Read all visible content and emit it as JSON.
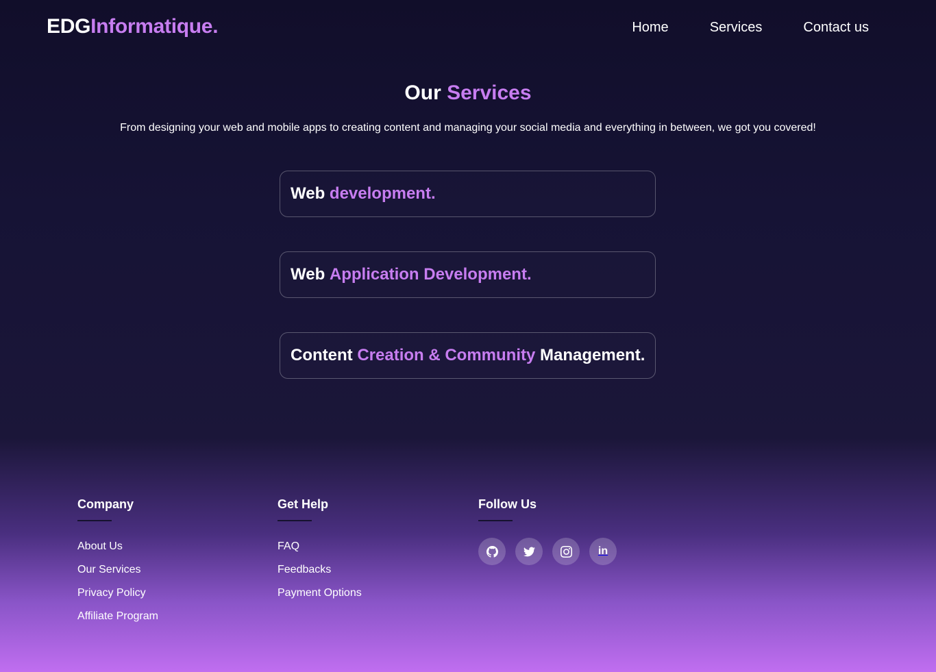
{
  "header": {
    "logo_main": "EDG",
    "logo_accent": "Informatique.",
    "nav": [
      {
        "label": "Home"
      },
      {
        "label": "Services"
      },
      {
        "label": "Contact us"
      }
    ]
  },
  "services": {
    "title_white": "Our",
    "title_accent": "Services",
    "subtitle": "From designing your web and mobile apps to creating content and managing your social media and everything in between, we got you covered!",
    "cards": [
      {
        "part1": "Web",
        "part2": "development."
      },
      {
        "part1": "Web",
        "part2": "Application Development."
      },
      {
        "part1": "Content",
        "part2": "Creation & Community",
        "part3": "Management."
      }
    ]
  },
  "footer": {
    "company": {
      "heading": "Company",
      "links": [
        "About Us",
        "Our Services",
        "Privacy Policy",
        "Affiliate Program"
      ]
    },
    "help": {
      "heading": "Get Help",
      "links": [
        "FAQ",
        "Feedbacks",
        "Payment Options"
      ]
    },
    "follow": {
      "heading": "Follow Us",
      "icons": [
        "github-icon",
        "twitter-icon",
        "instagram-icon",
        "linkedin-icon"
      ],
      "linkedin_text": "in"
    }
  },
  "colors": {
    "accent": "#c77df0",
    "background_top": "#110e2a",
    "background_bottom": "#c06ef0"
  }
}
